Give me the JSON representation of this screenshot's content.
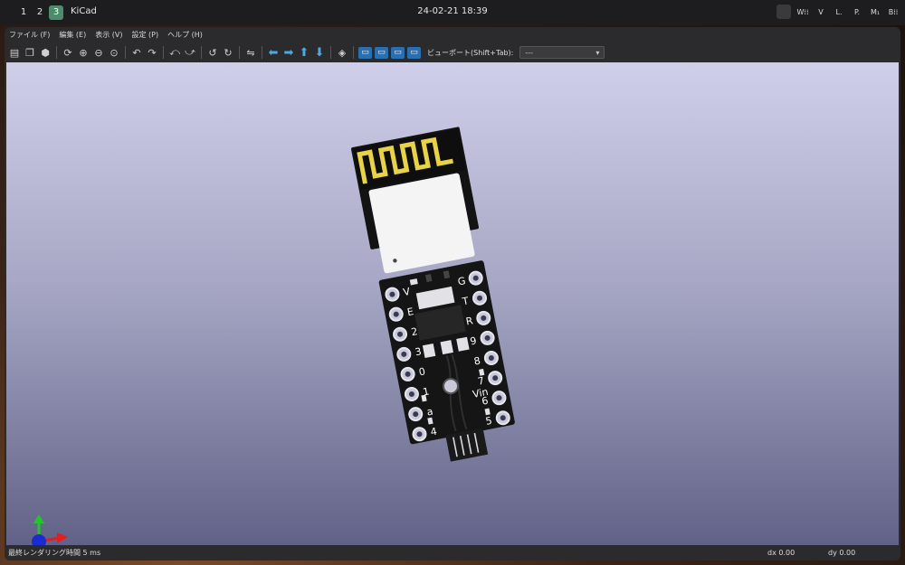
{
  "topbar": {
    "workspaces": [
      "1",
      "2",
      "3"
    ],
    "active_workspace": "3",
    "app_title": "KiCad",
    "clock": "24-02-21 18:39",
    "tray_labels": [
      "W⁞⁞",
      "V",
      "L.",
      "P.",
      "M₁",
      "B⁞⁞"
    ]
  },
  "menu": {
    "items": [
      "ファイル (F)",
      "編集 (E)",
      "表示 (V)",
      "設定 (P)",
      "ヘルプ (H)"
    ]
  },
  "toolbar": {
    "viewport_label": "ビューポート(Shift+Tab):",
    "viewport_value": "---",
    "icons": [
      "render-icon",
      "copy-icon",
      "3d-box-icon",
      "refresh-icon",
      "zoom-in-icon",
      "zoom-out-icon",
      "zoom-fit-icon",
      "rotate-x-icon",
      "rotate-x-reverse-icon",
      "rotate-y-icon",
      "rotate-y-reverse-icon",
      "rotate-z-icon",
      "rotate-z-reverse-icon",
      "flip-icon",
      "arrow-left-icon",
      "arrow-right-icon",
      "arrow-up-icon",
      "arrow-down-icon",
      "ortho-icon",
      "view-top-icon",
      "view-bottom-icon",
      "view-front-icon",
      "view-back-icon"
    ]
  },
  "board": {
    "left_pins": [
      "V",
      "E",
      "2",
      "3",
      "0",
      "1",
      "a",
      "4"
    ],
    "right_pins": [
      "G",
      "T",
      "R",
      "9",
      "8",
      "7",
      "6",
      "5"
    ],
    "center_label": "Vin",
    "colors": {
      "pcb": "#151515",
      "gold": "#e8d24a",
      "shield": "#f4f4f4",
      "pad": "#c9c9d8"
    }
  },
  "status": {
    "render_time": "最終レンダリング時間 5 ms",
    "dx": "dx 0.00",
    "dy": "dy 0.00"
  }
}
